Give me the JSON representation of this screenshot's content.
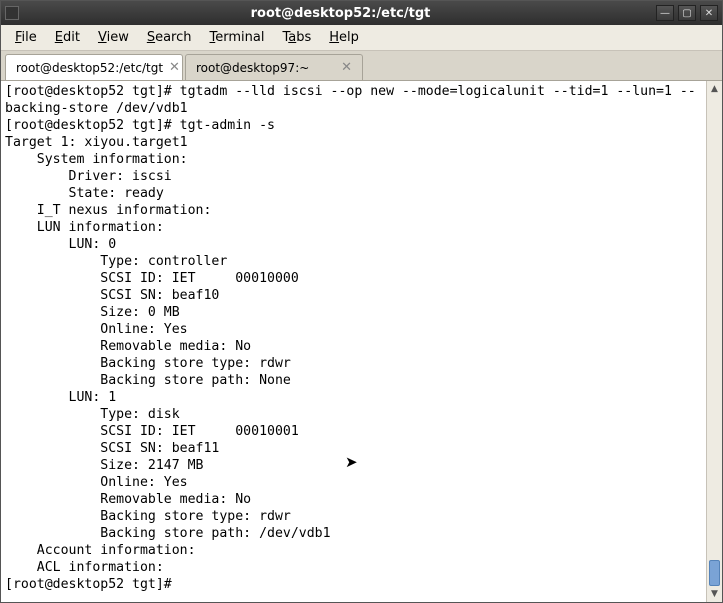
{
  "window": {
    "title": "root@desktop52:/etc/tgt"
  },
  "menubar": {
    "file": "File",
    "edit": "Edit",
    "view": "View",
    "search": "Search",
    "terminal": "Terminal",
    "tabs": "Tabs",
    "help": "Help"
  },
  "tabs": [
    {
      "label": "root@desktop52:/etc/tgt",
      "active": true
    },
    {
      "label": "root@desktop97:~",
      "active": false
    }
  ],
  "terminal": {
    "lines": [
      "[root@desktop52 tgt]# tgtadm --lld iscsi --op new --mode=logicalunit --tid=1 --lun=1 --",
      "backing-store /dev/vdb1",
      "[root@desktop52 tgt]# tgt-admin -s",
      "Target 1: xiyou.target1",
      "    System information:",
      "        Driver: iscsi",
      "        State: ready",
      "    I_T nexus information:",
      "    LUN information:",
      "        LUN: 0",
      "            Type: controller",
      "            SCSI ID: IET     00010000",
      "            SCSI SN: beaf10",
      "            Size: 0 MB",
      "            Online: Yes",
      "            Removable media: No",
      "            Backing store type: rdwr",
      "            Backing store path: None",
      "        LUN: 1",
      "            Type: disk",
      "            SCSI ID: IET     00010001",
      "            SCSI SN: beaf11",
      "            Size: 2147 MB",
      "            Online: Yes",
      "            Removable media: No",
      "            Backing store type: rdwr",
      "            Backing store path: /dev/vdb1",
      "    Account information:",
      "    ACL information:",
      "[root@desktop52 tgt]# "
    ]
  }
}
